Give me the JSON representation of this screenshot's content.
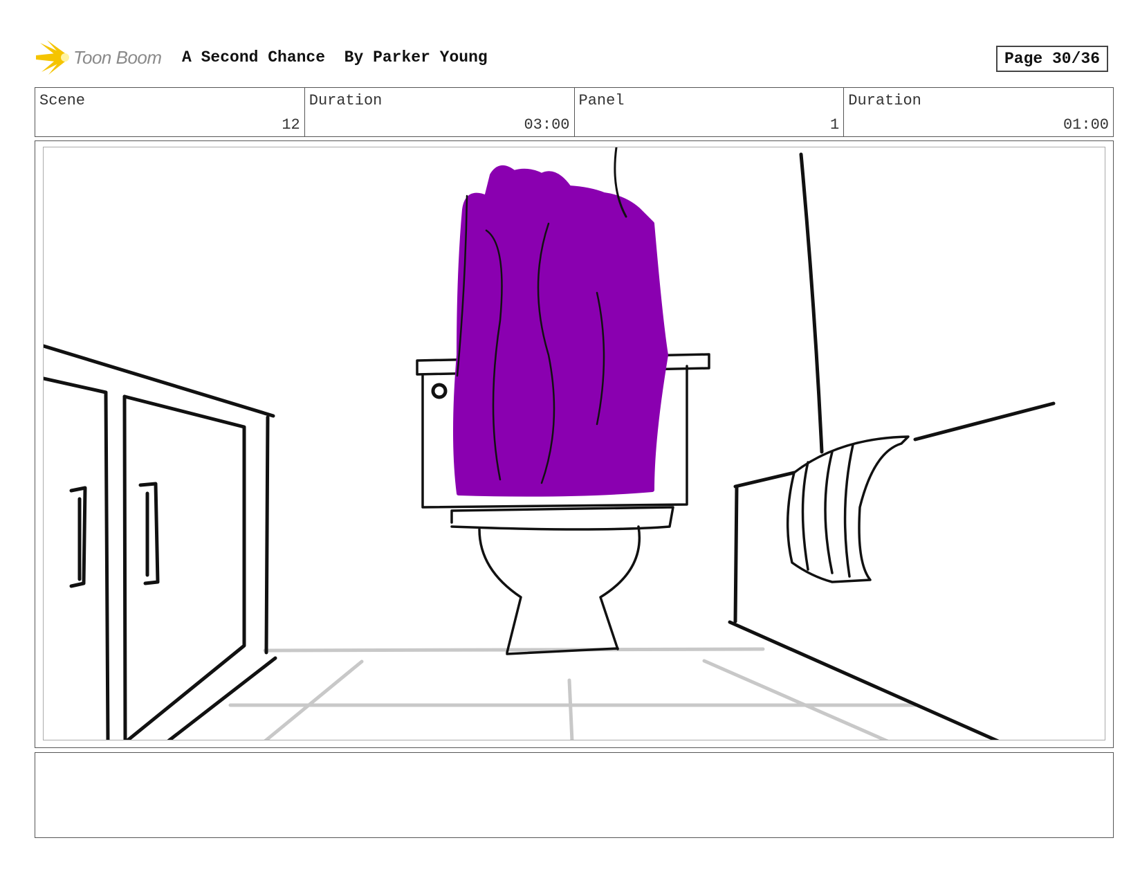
{
  "header": {
    "logo_text": "Toon Boom",
    "project_title": "A Second Chance",
    "author": "By Parker Young",
    "page": "Page 30/36"
  },
  "info": {
    "scene_label": "Scene",
    "scene_value": "12",
    "scene_duration_label": "Duration",
    "scene_duration_value": "03:00",
    "panel_label": "Panel",
    "panel_value": "1",
    "panel_duration_label": "Duration",
    "panel_duration_value": "01:00"
  },
  "notes": {
    "text": ""
  },
  "colors": {
    "seat_cover": "#8a00b0",
    "logo_star": "#f5c400"
  }
}
